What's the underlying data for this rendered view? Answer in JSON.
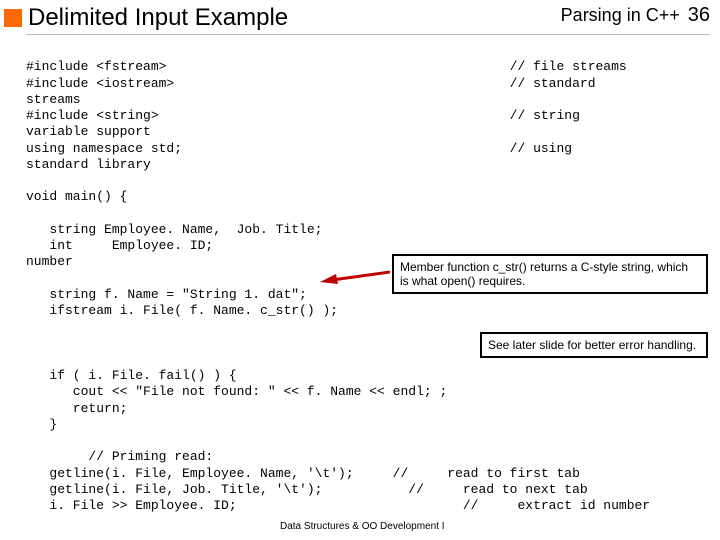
{
  "header": {
    "title": "Delimited Input Example",
    "subtitle": "Parsing in C++",
    "page": "36"
  },
  "code": {
    "l1": "#include <fstream>                                            // file streams",
    "l2": "#include <iostream>                                           // standard",
    "l3": "streams",
    "l4": "#include <string>                                             // string",
    "l5": "variable support",
    "l6": "using namespace std;                                          // using",
    "l7": "standard library",
    "l8": "",
    "l9": "void main() {",
    "l10": "",
    "l11": "   string Employee. Name,  Job. Title;",
    "l12": "   int     Employee. ID;",
    "l13": "number",
    "l14": "",
    "l15": "   string f. Name = \"String 1. dat\";",
    "l16": "   ifstream i. File( f. Name. c_str() );",
    "l17": "",
    "l18": "",
    "l19": "",
    "l20": "   if ( i. File. fail() ) {",
    "l21": "      cout << \"File not found: \" << f. Name << endl; ;",
    "l22": "      return;",
    "l23": "   }",
    "l24": "",
    "l25": "        // Priming read:",
    "l26": "   getline(i. File, Employee. Name, '\\t');     //     read to first tab",
    "l27": "   getline(i. File, Job. Title, '\\t');           //     read to next tab",
    "l28": "   i. File >> Employee. ID;                             //     extract id number"
  },
  "callouts": {
    "c1": "Member function c_str() returns a C-style string, which is what open() requires.",
    "c2": "See later slide for better error handling."
  },
  "footer": "Data Structures & OO Development I"
}
